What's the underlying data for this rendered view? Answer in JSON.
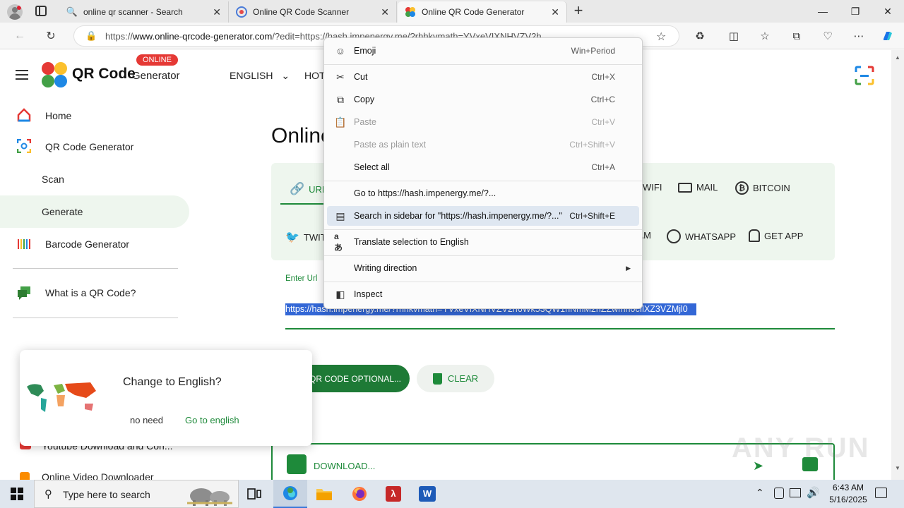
{
  "browser": {
    "tabs": [
      {
        "title": "online qr scanner - Search",
        "icon": "search-icon"
      },
      {
        "title": "Online QR Code Scanner",
        "icon": "qr-site-icon"
      },
      {
        "title": "Online QR Code Generator",
        "icon": "qr-site-icon",
        "active": true
      }
    ],
    "new_tab_label": "+",
    "url_prefix": "https://",
    "url_domain": "www.online-qrcode-generator.com",
    "url_rest": "/?edit=https://hash.impenergy.me/?rhhkvmath=YVxeVIXNHVZV2h..."
  },
  "site": {
    "logo_title": "QR Code",
    "logo_subtitle": "Generator",
    "online_badge": "ONLINE",
    "language": "ENGLISH",
    "hot_menu": "HOT",
    "nav": [
      {
        "label": "Home",
        "icon": "home-icon"
      },
      {
        "label": "QR Code Generator",
        "icon": "qr-generator-icon"
      },
      {
        "label": "Scan",
        "icon": ""
      },
      {
        "label": "Generate",
        "icon": "",
        "active": true
      },
      {
        "label": "Barcode Generator",
        "icon": "barcode-icon"
      },
      {
        "label": "What is a QR Code?",
        "icon": "chat-icon"
      },
      {
        "label": "Youtube Download and Con...",
        "icon": "youtube-icon"
      },
      {
        "label": "Online Video Downloader",
        "icon": "video-icon"
      }
    ],
    "page_title": "Online",
    "type_tabs": [
      "URL",
      "WIFI",
      "MAIL",
      "BITCOIN",
      "TWITTER",
      "TELEGRAM",
      "WHATSAPP",
      "GET APP"
    ],
    "enter_url_label": "Enter Url",
    "url_value": "https://hash.impenergy.me/?rhhkvmath=YVxeVIXNHVZV2h6Wk53QW1hNmM2hZZwmh0cIlXZ3VZMjl0",
    "optional_button": "QR CODE OPTIONAL...",
    "clear_button": "CLEAR",
    "download_label": "DOWNLOAD..."
  },
  "context_menu": {
    "items": [
      {
        "label": "Emoji",
        "shortcut": "Win+Period",
        "icon": "emoji-icon"
      },
      {
        "label": "Cut",
        "shortcut": "Ctrl+X",
        "icon": "scissors-icon"
      },
      {
        "label": "Copy",
        "shortcut": "Ctrl+C",
        "icon": "copy-icon"
      },
      {
        "label": "Paste",
        "shortcut": "Ctrl+V",
        "icon": "paste-icon",
        "disabled": true
      },
      {
        "label": "Paste as plain text",
        "shortcut": "Ctrl+Shift+V",
        "icon": "",
        "disabled": true
      },
      {
        "label": "Select all",
        "shortcut": "Ctrl+A",
        "icon": ""
      },
      {
        "label": "Go to https://hash.impenergy.me/?...",
        "shortcut": "",
        "icon": ""
      },
      {
        "label": "Search in sidebar for \"https://hash.impenergy.me/?...\"",
        "shortcut": "Ctrl+Shift+E",
        "icon": "sidebar-search-icon",
        "highlight": true
      },
      {
        "label": "Translate selection to English",
        "shortcut": "",
        "icon": "translate-icon"
      },
      {
        "label": "Writing direction",
        "shortcut": "",
        "icon": "",
        "submenu": true
      },
      {
        "label": "Inspect",
        "shortcut": "",
        "icon": "inspect-icon"
      }
    ]
  },
  "language_popup": {
    "title": "Change to English?",
    "no_button": "no need",
    "yes_button": "Go to english"
  },
  "taskbar": {
    "search_placeholder": "Type here to search",
    "time": "6:43 AM",
    "date": "5/16/2025"
  },
  "watermark": "ANY RUN",
  "colors": {
    "green": "#1e8a3a",
    "selection": "#3367d6",
    "tabbar": "#e9e9e9"
  }
}
